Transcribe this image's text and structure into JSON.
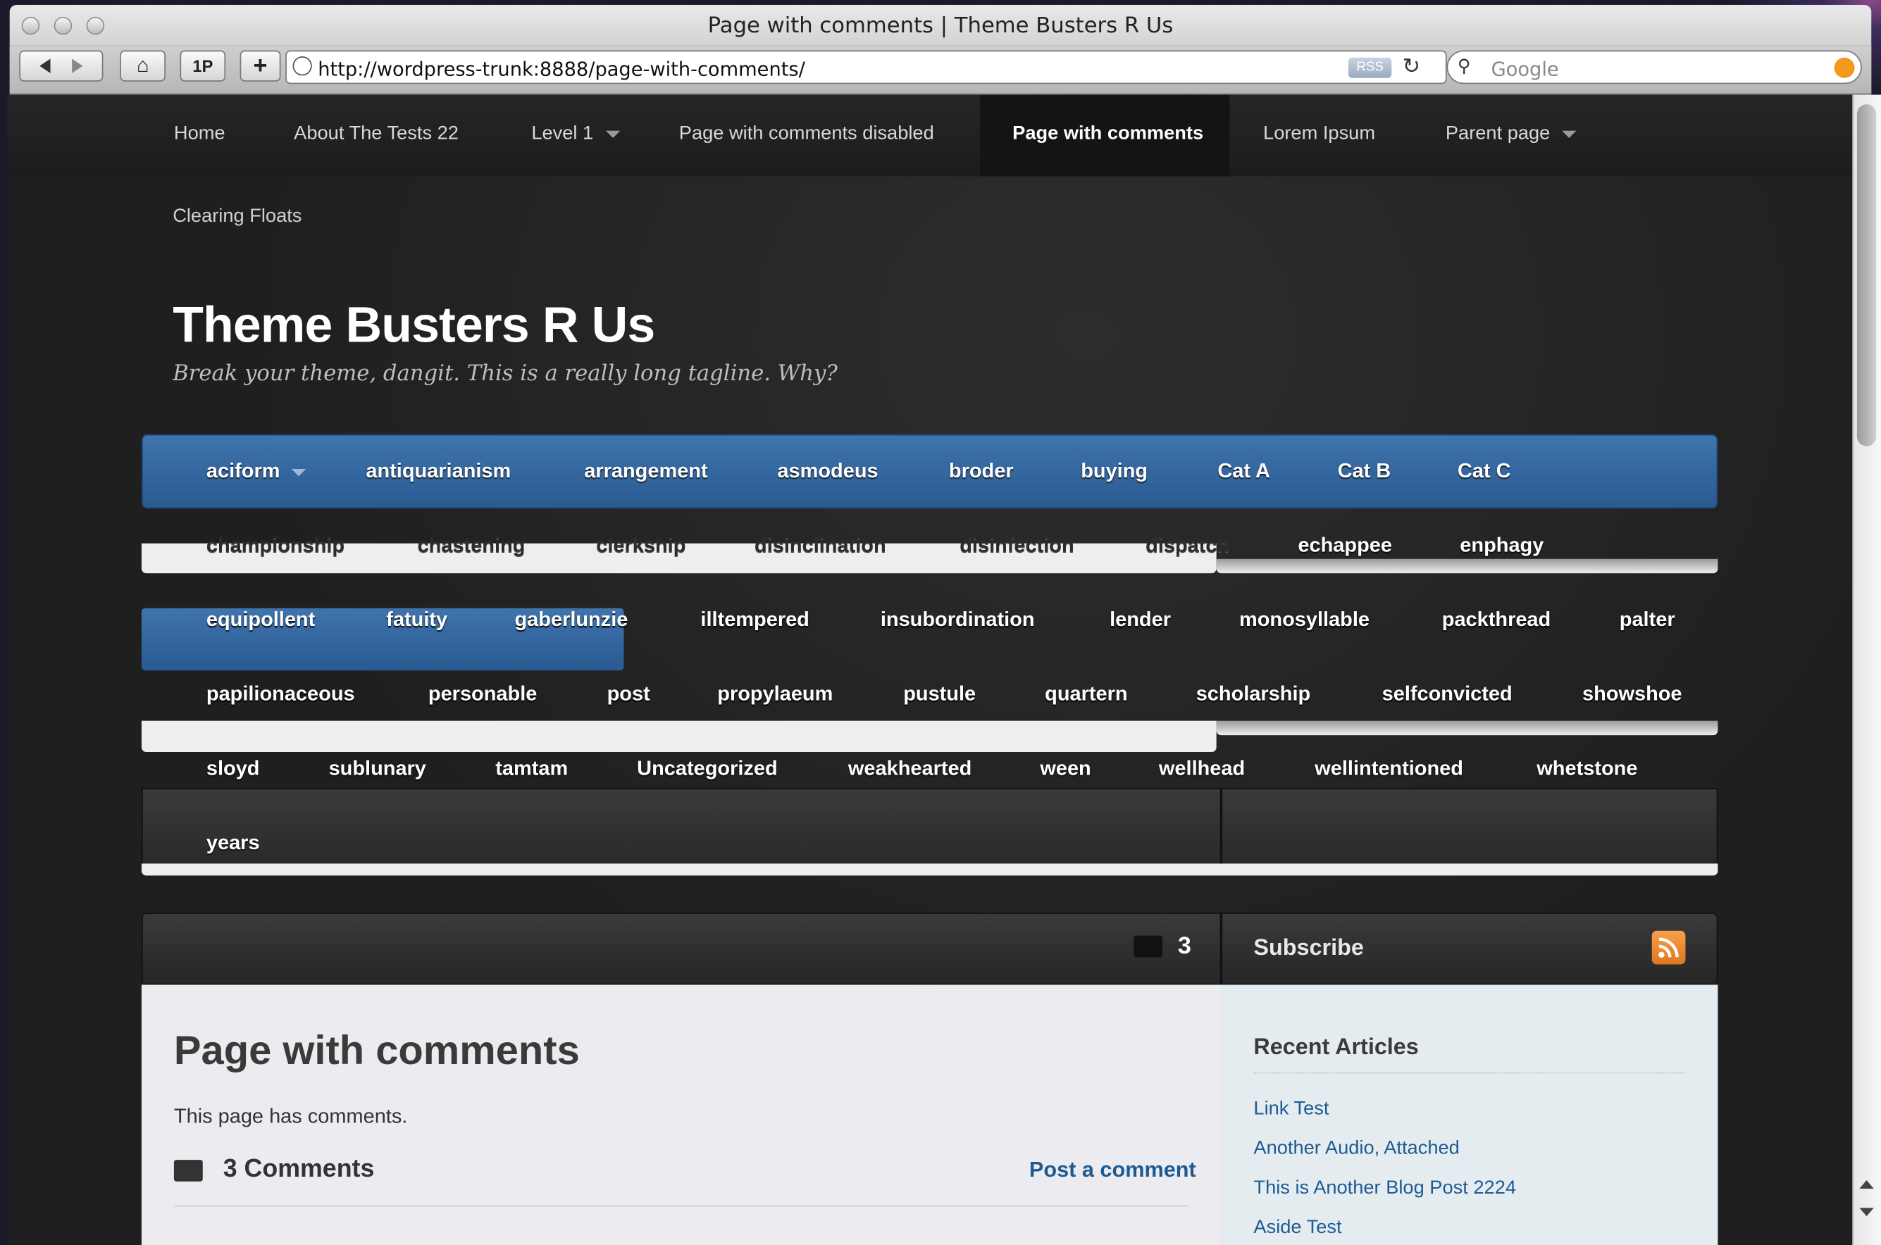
{
  "browser": {
    "window_title": "Page with comments | Theme Busters R Us",
    "url": "http://wordpress-trunk:8888/page-with-comments/",
    "rss_badge": "RSS",
    "search_placeholder": "Google",
    "onep_label": "1P",
    "add_label": "+"
  },
  "topnav": {
    "items": [
      {
        "label": "Home"
      },
      {
        "label": "About The Tests 22"
      },
      {
        "label": "Level 1"
      },
      {
        "label": "Page with comments disabled"
      },
      {
        "label": "Page with comments"
      },
      {
        "label": "Lorem Ipsum"
      },
      {
        "label": "Parent page"
      }
    ],
    "second_row": "Clearing Floats"
  },
  "site": {
    "title": "Theme Busters R Us",
    "tagline": "Break your theme, dangit. This is a really long tagline. Why?"
  },
  "categories": {
    "row1": [
      "aciform",
      "antiquarianism",
      "arrangement",
      "asmodeus",
      "broder",
      "buying",
      "Cat A",
      "Cat B",
      "Cat C"
    ],
    "row2": [
      "championship",
      "chastening",
      "clerkship",
      "disinclination",
      "disinfection",
      "dispatch",
      "echappee",
      "enphagy"
    ],
    "row3": [
      "equipollent",
      "fatuity",
      "gaberlunzie",
      "illtempered",
      "insubordination",
      "lender",
      "monosyllable",
      "packthread",
      "palter"
    ],
    "row4": [
      "papilionaceous",
      "personable",
      "post",
      "propylaeum",
      "pustule",
      "quartern",
      "scholarship",
      "selfconvicted",
      "showshoe"
    ],
    "row5": [
      "sloyd",
      "sublunary",
      "tamtam",
      "Uncategorized",
      "weakhearted",
      "ween",
      "wellhead",
      "wellintentioned",
      "whetstone"
    ],
    "row6": [
      "years"
    ]
  },
  "content": {
    "comment_count": "3",
    "page_title": "Page with comments",
    "page_text": "This page has comments.",
    "comments_heading": "3 Comments",
    "post_comment": "Post a comment"
  },
  "sidebar": {
    "subscribe": "Subscribe",
    "recent_title": "Recent Articles",
    "recent": [
      "Link Test",
      "Another Audio, Attached",
      "This is Another Blog Post 2224",
      "Aside Test"
    ]
  },
  "colors": {
    "category_blue": "#2f6399",
    "link_blue": "#1e5a92",
    "rss_orange": "#f08c2e"
  }
}
